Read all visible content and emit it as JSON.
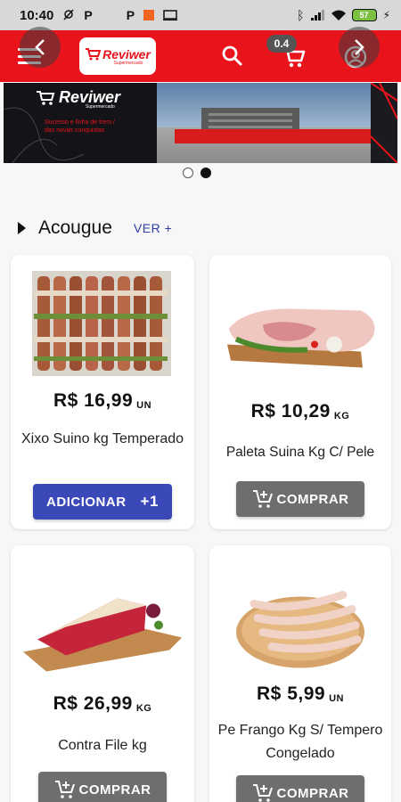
{
  "status_bar": {
    "time": "10:40",
    "left_icons": [
      "location-off-icon",
      "p-icon",
      "p-icon",
      "orange-square-icon",
      "cast-icon"
    ],
    "right_icons": [
      "bluetooth-icon",
      "signal-icon",
      "wifi-icon"
    ],
    "battery": "57"
  },
  "app_bar": {
    "brand": "Reviwer",
    "brand_sub": "Supermercado",
    "cart_count": "0.4",
    "icons": [
      "menu-icon",
      "search-icon",
      "cart-icon",
      "account-icon"
    ],
    "color": "#e8131b"
  },
  "banner": {
    "brand": "Reviwer",
    "brand_sub": "Supermercado",
    "tagline": "Sucesso e linha de trem / das novas conquistas",
    "active_slide": 2,
    "slide_count": 2
  },
  "section": {
    "title": "Acougue",
    "see_more": "VER +"
  },
  "products": [
    {
      "price": "R$ 16,99",
      "unit": "UN",
      "name": "Xixo Suino kg Temperado",
      "button": "ADICIONAR",
      "button_extra": "+1",
      "button_type": "add"
    },
    {
      "price": "R$ 10,29",
      "unit": "KG",
      "name": "Paleta Suina Kg C/ Pele",
      "button": "COMPRAR",
      "button_type": "buy"
    },
    {
      "price": "R$ 26,99",
      "unit": "KG",
      "name": "Contra File kg",
      "button": "COMPRAR",
      "button_type": "buy"
    },
    {
      "price": "R$ 5,99",
      "unit": "UN",
      "name": "Pe Frango Kg S/ Tempero Congelado",
      "button": "COMPRAR",
      "button_type": "buy"
    }
  ],
  "colors": {
    "primary_red": "#e8131b",
    "add_button": "#3b48b8",
    "buy_button": "#6e6e6e",
    "link": "#2f3ea8"
  }
}
